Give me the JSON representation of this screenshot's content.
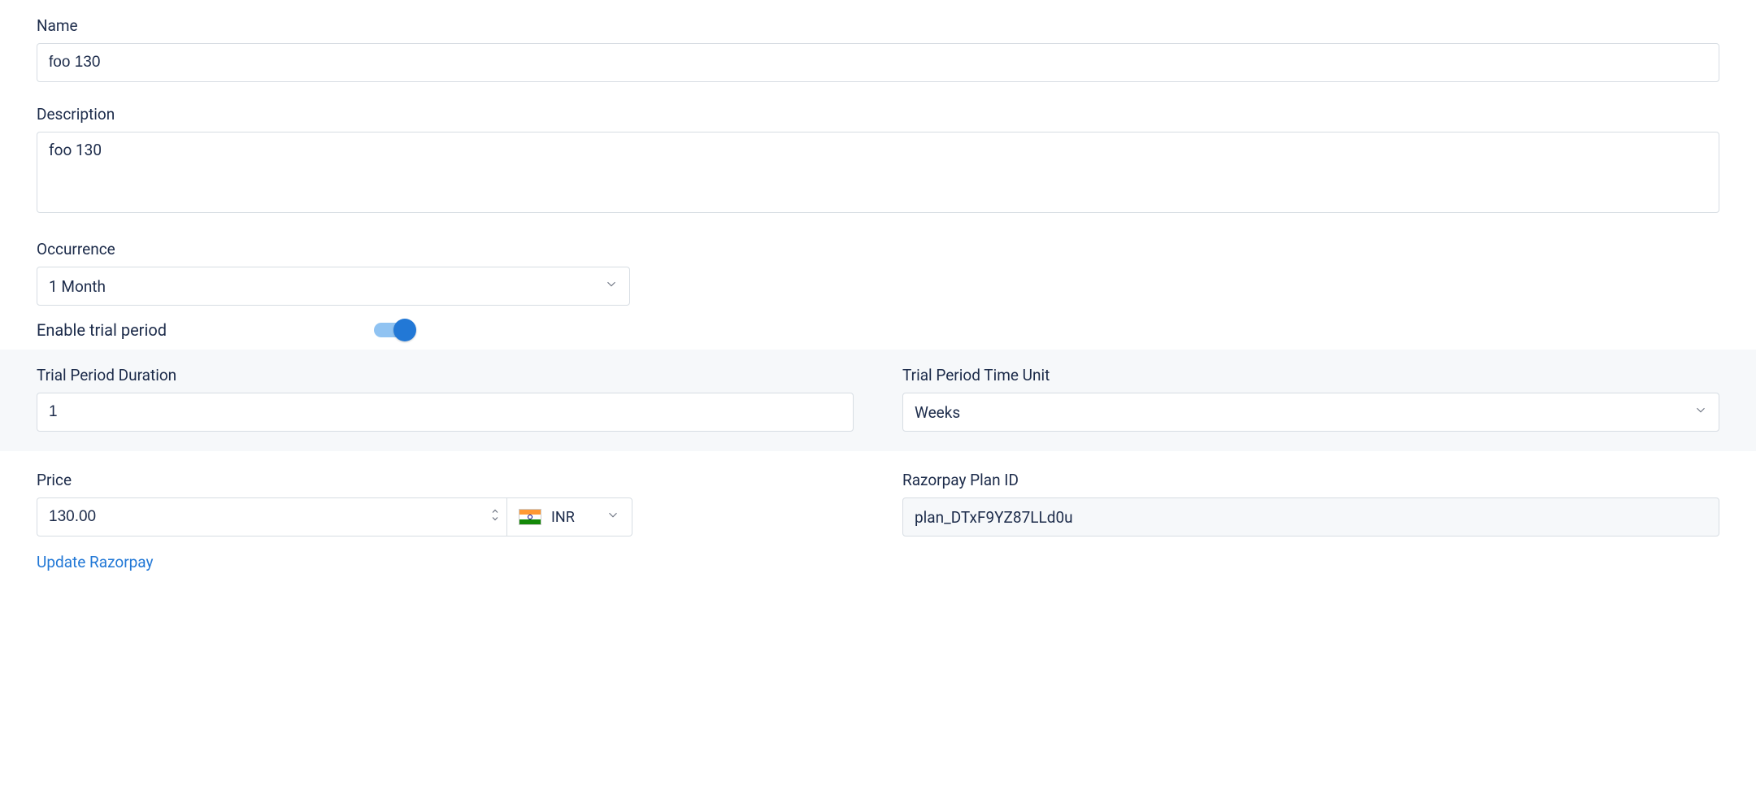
{
  "form": {
    "name": {
      "label": "Name",
      "value": "foo 130"
    },
    "description": {
      "label": "Description",
      "value": "foo 130"
    },
    "occurrence": {
      "label": "Occurrence",
      "value": "1 Month"
    },
    "enable_trial": {
      "label": "Enable trial period",
      "on": true
    },
    "trial_duration": {
      "label": "Trial Period Duration",
      "value": "1"
    },
    "trial_unit": {
      "label": "Trial Period Time Unit",
      "value": "Weeks"
    },
    "price": {
      "label": "Price",
      "value": "130.00",
      "currency": "INR"
    },
    "razorpay_plan_id": {
      "label": "Razorpay Plan ID",
      "value": "plan_DTxF9YZ87LLd0u"
    },
    "update_link": "Update Razorpay"
  }
}
